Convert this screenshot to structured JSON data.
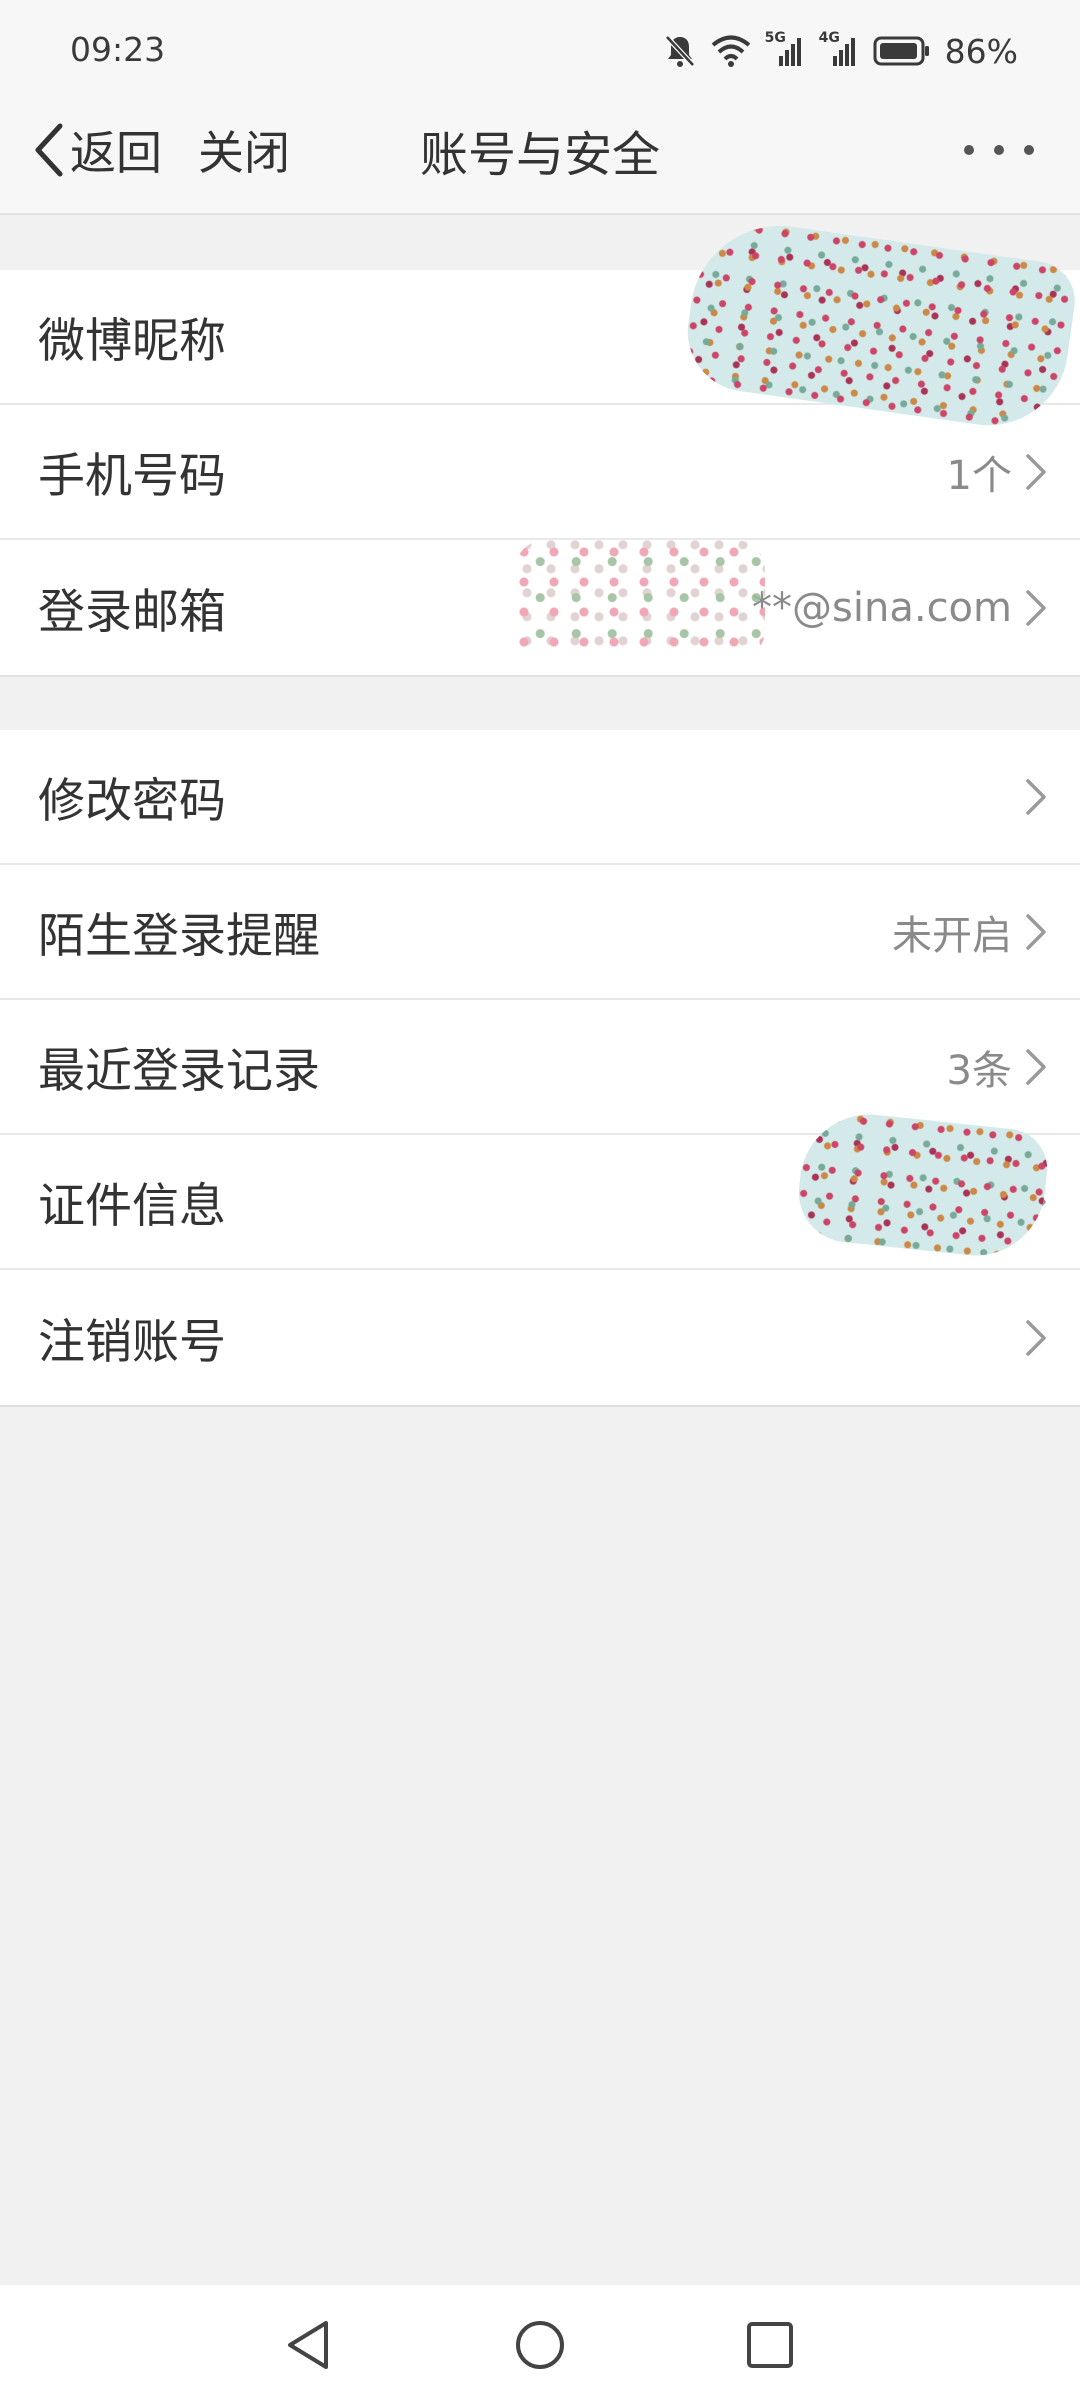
{
  "status_bar": {
    "time": "09:23",
    "network_1": "5G",
    "network_2": "4G",
    "battery": "86%"
  },
  "nav": {
    "back_label": "返回",
    "close_label": "关闭",
    "title": "账号与安全"
  },
  "groups": [
    {
      "items": [
        {
          "label": "微博昵称",
          "value": ""
        },
        {
          "label": "手机号码",
          "value": "1个"
        },
        {
          "label": "登录邮箱",
          "value": "**@sina.com"
        }
      ]
    },
    {
      "items": [
        {
          "label": "修改密码",
          "value": ""
        },
        {
          "label": "陌生登录提醒",
          "value": "未开启"
        },
        {
          "label": "最近登录记录",
          "value": "3条"
        },
        {
          "label": "证件信息",
          "value": ""
        },
        {
          "label": "注销账号",
          "value": ""
        }
      ]
    }
  ],
  "colors": {
    "background": "#f1f1f1",
    "card": "#ffffff",
    "text_primary": "#333333",
    "text_secondary": "#8a8a8a"
  },
  "icons": {
    "back": "chevron-left-icon",
    "more": "more-dots-icon",
    "row_arrow": "chevron-right-icon",
    "sys_back": "triangle-back-icon",
    "sys_home": "circle-home-icon",
    "sys_recent": "square-recent-icon"
  }
}
